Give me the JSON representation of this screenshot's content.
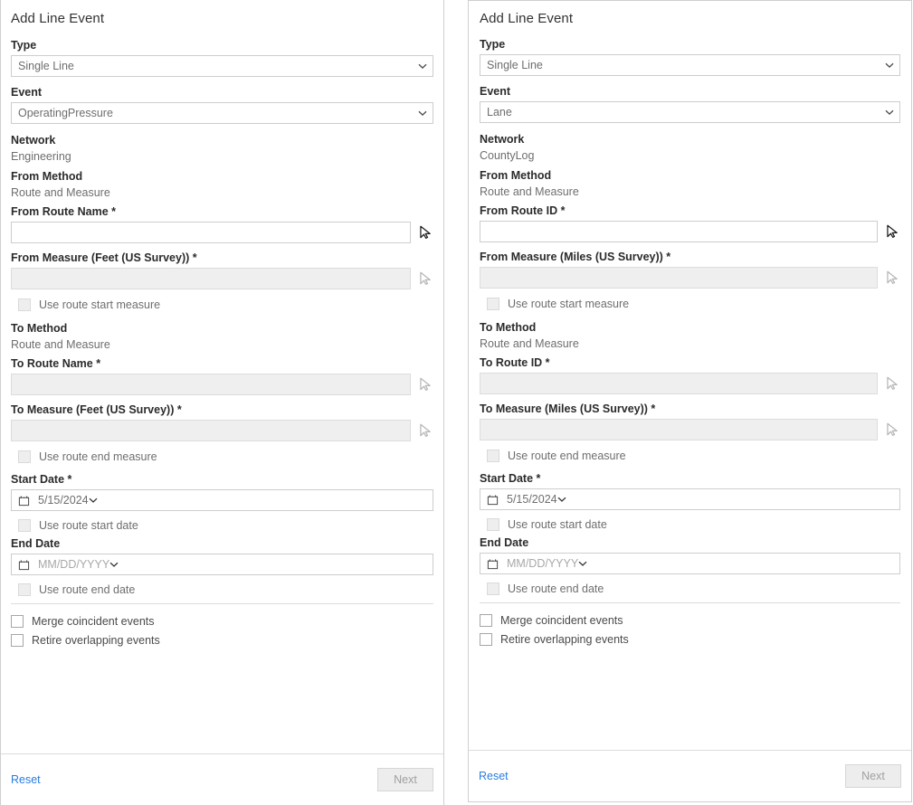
{
  "panels": [
    {
      "title": "Add Line Event",
      "type": {
        "label": "Type",
        "value": "Single Line"
      },
      "event": {
        "label": "Event",
        "value": "OperatingPressure"
      },
      "network": {
        "label": "Network",
        "value": "Engineering"
      },
      "from_method": {
        "label": "From Method",
        "value": "Route and Measure"
      },
      "from_route": {
        "label": "From Route Name *",
        "value": ""
      },
      "from_measure": {
        "label": "From Measure (Feet (US Survey)) *",
        "value": ""
      },
      "use_route_start_measure": "Use route start measure",
      "to_method": {
        "label": "To Method",
        "value": "Route and Measure"
      },
      "to_route": {
        "label": "To Route Name *",
        "value": ""
      },
      "to_measure": {
        "label": "To Measure (Feet (US Survey)) *",
        "value": ""
      },
      "use_route_end_measure": "Use route end measure",
      "start_date": {
        "label": "Start Date *",
        "value": "5/15/2024"
      },
      "use_route_start_date": "Use route start date",
      "end_date": {
        "label": "End Date",
        "value": "MM/DD/YYYY"
      },
      "use_route_end_date": "Use route end date",
      "merge_coincident": "Merge coincident events",
      "retire_overlapping": "Retire overlapping events",
      "reset": "Reset",
      "next": "Next"
    },
    {
      "title": "Add Line Event",
      "type": {
        "label": "Type",
        "value": "Single Line"
      },
      "event": {
        "label": "Event",
        "value": "Lane"
      },
      "network": {
        "label": "Network",
        "value": "CountyLog"
      },
      "from_method": {
        "label": "From Method",
        "value": "Route and Measure"
      },
      "from_route": {
        "label": "From Route ID *",
        "value": ""
      },
      "from_measure": {
        "label": "From Measure (Miles (US Survey)) *",
        "value": ""
      },
      "use_route_start_measure": "Use route start measure",
      "to_method": {
        "label": "To Method",
        "value": "Route and Measure"
      },
      "to_route": {
        "label": "To Route ID *",
        "value": ""
      },
      "to_measure": {
        "label": "To Measure (Miles (US Survey)) *",
        "value": ""
      },
      "use_route_end_measure": "Use route end measure",
      "start_date": {
        "label": "Start Date *",
        "value": "5/15/2024"
      },
      "use_route_start_date": "Use route start date",
      "end_date": {
        "label": "End Date",
        "value": "MM/DD/YYYY"
      },
      "use_route_end_date": "Use route end date",
      "merge_coincident": "Merge coincident events",
      "retire_overlapping": "Retire overlapping events",
      "reset": "Reset",
      "next": "Next"
    }
  ],
  "colors": {
    "link": "#2a7ce0",
    "label_text": "#2b2b2b",
    "value_text": "#6e6e6e",
    "border": "#cdcdcd",
    "disabled_fill": "#efefef"
  }
}
